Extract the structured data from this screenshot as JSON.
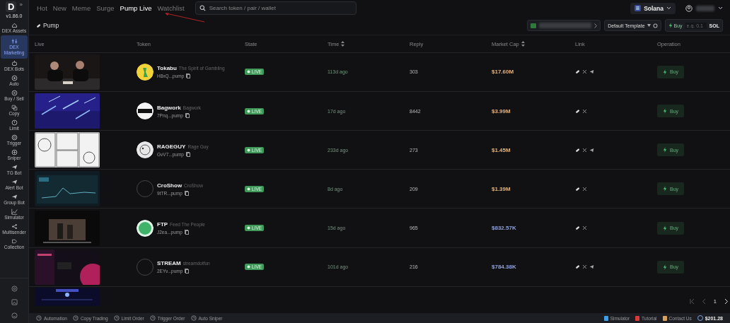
{
  "sidebar": {
    "logo": "D",
    "collapse": "»",
    "version": "v1.86.0",
    "items": [
      {
        "label": "DEX Assets",
        "selected": false
      },
      {
        "label": "DEX Marketing",
        "selected": true
      },
      {
        "label": "DEX Bots",
        "selected": false
      },
      {
        "label": "Auto",
        "selected": false
      },
      {
        "label": "Buy / Sell",
        "selected": false
      },
      {
        "label": "Copy",
        "selected": false
      },
      {
        "label": "Limit",
        "selected": false
      },
      {
        "label": "Trigger",
        "selected": false
      },
      {
        "label": "Sniper",
        "selected": false
      },
      {
        "label": "TG Bot",
        "selected": false
      },
      {
        "label": "Alert Bot",
        "selected": false
      },
      {
        "label": "Group Bot",
        "selected": false
      },
      {
        "label": "Simulator",
        "selected": false
      },
      {
        "label": "Multisender",
        "selected": false
      },
      {
        "label": "Collection",
        "selected": false
      }
    ]
  },
  "tabs": [
    {
      "label": "Hot",
      "selected": false
    },
    {
      "label": "New",
      "selected": false
    },
    {
      "label": "Meme",
      "selected": false
    },
    {
      "label": "Surge",
      "selected": false
    },
    {
      "label": "Pump Live",
      "selected": true
    },
    {
      "label": "Watchlist",
      "selected": false
    }
  ],
  "search": {
    "placeholder": "Search token / pair / wallet"
  },
  "network": {
    "label": "Solana"
  },
  "filter": {
    "label": "Pump"
  },
  "template": {
    "label": "Default Template"
  },
  "quick_buy": {
    "label": "Buy",
    "placeholder": "e.g. 0.1",
    "unit": "SOL"
  },
  "table": {
    "columns": [
      "Live",
      "Token",
      "State",
      "Time",
      "Reply",
      "Market Cap",
      "Link",
      "Operation"
    ],
    "rows": [
      {
        "avatar": {
          "kind": "picture"
        },
        "name": "Tokabu",
        "subtitle": "The Spirit of Gambling",
        "address": "H8xQ...pump",
        "state": "LIVE",
        "time": "113d ago",
        "reply": "303",
        "market_cap": {
          "text": "$17.60M",
          "color": "#e8b37c"
        },
        "links": [
          {
            "kind": "pump"
          },
          {
            "kind": "x"
          },
          {
            "kind": "telegram"
          }
        ],
        "action": "Buy"
      },
      {
        "avatar": {
          "kind": "picture"
        },
        "name": "Bagwork",
        "subtitle": "Bagwork",
        "address": "7Pnq...pump",
        "state": "LIVE",
        "time": "17d ago",
        "reply": "8442",
        "market_cap": {
          "text": "$3.99M",
          "color": "#e8b37c"
        },
        "links": [
          {
            "kind": "pump"
          },
          {
            "kind": "x"
          }
        ],
        "action": "Buy"
      },
      {
        "avatar": {
          "kind": "picture"
        },
        "name": "RAGEGUY",
        "subtitle": "Rage Guy",
        "address": "GvV7...pump",
        "state": "LIVE",
        "time": "233d ago",
        "reply": "273",
        "market_cap": {
          "text": "$1.45M",
          "color": "#e8b37c"
        },
        "links": [
          {
            "kind": "pump"
          },
          {
            "kind": "x"
          },
          {
            "kind": "telegram"
          }
        ],
        "action": "Buy"
      },
      {
        "avatar": {
          "kind": "empty"
        },
        "name": "CroShow",
        "subtitle": "CroShow",
        "address": "9tTR...pump",
        "state": "LIVE",
        "time": "8d ago",
        "reply": "209",
        "market_cap": {
          "text": "$1.39M",
          "color": "#e8b37c"
        },
        "links": [
          {
            "kind": "pump"
          },
          {
            "kind": "x"
          }
        ],
        "action": "Buy"
      },
      {
        "avatar": {
          "kind": "picture"
        },
        "name": "FTP",
        "subtitle": "Feed The People",
        "address": "J2ea...pump",
        "state": "LIVE",
        "time": "15d ago",
        "reply": "965",
        "market_cap": {
          "text": "$832.57K",
          "color": "#8fa3e0"
        },
        "links": [
          {
            "kind": "pump"
          },
          {
            "kind": "x"
          }
        ],
        "action": "Buy"
      },
      {
        "avatar": {
          "kind": "empty"
        },
        "name": "STREAM",
        "subtitle": "streamdotfun",
        "address": "2EYv...pump",
        "state": "LIVE",
        "time": "101d ago",
        "reply": "216",
        "market_cap": {
          "text": "$784.38K",
          "color": "#8fa3e0"
        },
        "links": [
          {
            "kind": "pump"
          },
          {
            "kind": "x"
          },
          {
            "kind": "telegram"
          }
        ],
        "action": "Buy"
      }
    ],
    "partial_row": {
      "kind": "picture"
    }
  },
  "pagination": {
    "page": "1"
  },
  "bottom_bar": {
    "left": [
      "Automation",
      "Copy Trading",
      "Limit Order",
      "Trigger Order",
      "Auto Sniper"
    ],
    "right": [
      "Simulator",
      "Tutorial",
      "Contact Us"
    ],
    "balance": "$201.28"
  }
}
